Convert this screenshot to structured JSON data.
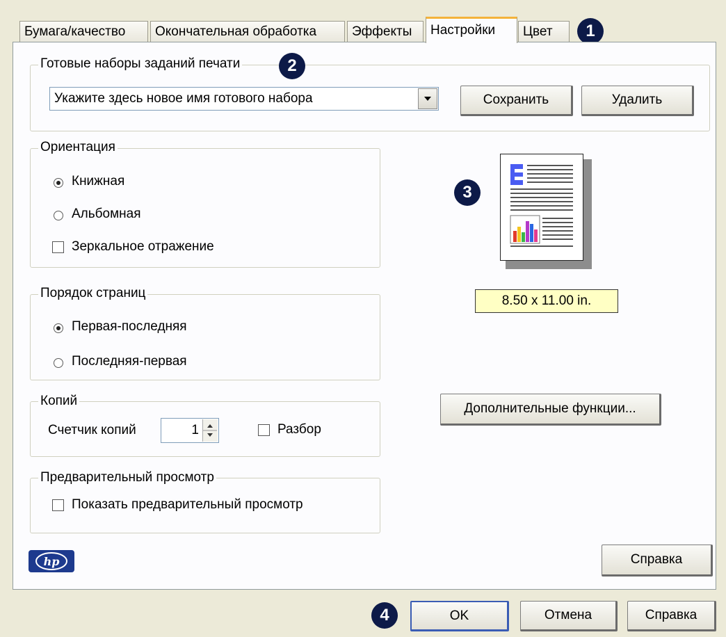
{
  "tabs": [
    {
      "label": "Бумага/качество"
    },
    {
      "label": "Окончательная обработка"
    },
    {
      "label": "Эффекты"
    },
    {
      "label": "Настройки"
    },
    {
      "label": "Цвет"
    }
  ],
  "callouts": [
    "1",
    "2",
    "3",
    "4"
  ],
  "presets": {
    "legend": "Готовые наборы заданий печати",
    "combo_value": "Укажите здесь новое имя готового набора",
    "save_label": "Сохранить",
    "delete_label": "Удалить"
  },
  "orientation": {
    "legend": "Ориентация",
    "portrait": "Книжная",
    "landscape": "Альбомная",
    "mirror": "Зеркальное отражение",
    "selected": "portrait",
    "mirror_checked": false
  },
  "page_order": {
    "legend": "Порядок страниц",
    "first_last": "Первая-последняя",
    "last_first": "Последняя-первая",
    "selected": "first_last"
  },
  "copies": {
    "legend": "Копий",
    "counter_label": "Счетчик копий",
    "count": "1",
    "collate_label": "Разбор",
    "collate_checked": false
  },
  "preview": {
    "legend": "Предварительный просмотр",
    "show_label": "Показать предварительный просмотр",
    "checked": false
  },
  "paper_size": "8.50 x 11.00 in.",
  "advanced_button": "Дополнительные функции...",
  "panel_help_button": "Справка",
  "footer": {
    "ok": "OK",
    "cancel": "Отмена",
    "help": "Справка"
  },
  "logo_text": "hp",
  "colors": {
    "callout": "#0d1a48",
    "active_tab_accent": "#f4b33a",
    "paper_label_bg": "#ffffc4",
    "hp_blue": "#1d3a8e"
  }
}
